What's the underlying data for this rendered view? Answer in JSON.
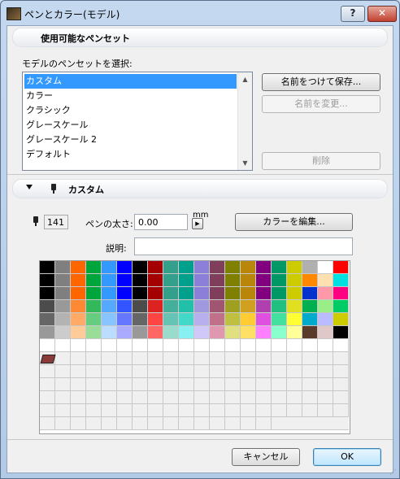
{
  "window": {
    "title": "ペンとカラー(モデル)",
    "help_label": "?",
    "close_label": "✕"
  },
  "available": {
    "section_title": "使用可能なペンセット",
    "select_label": "モデルのペンセットを選択:",
    "items": [
      {
        "label": "カスタム",
        "selected": true
      },
      {
        "label": "カラー",
        "selected": false
      },
      {
        "label": "クラシック",
        "selected": false
      },
      {
        "label": "グレースケール",
        "selected": false
      },
      {
        "label": "グレースケール 2",
        "selected": false
      },
      {
        "label": "デフォルト",
        "selected": false
      }
    ],
    "save_as_label": "名前をつけて保存...",
    "rename_label": "名前を変更...",
    "delete_label": "削除"
  },
  "custom": {
    "section_title": "カスタム",
    "pen_number": "141",
    "pen_weight_label": "ペンの太さ:",
    "pen_weight_value": "0.00",
    "unit": "mm",
    "description_label": "説明:",
    "description_value": "",
    "edit_color_label": "カラーを編集..."
  },
  "palette": {
    "rows": [
      [
        "#000000",
        "#7f7f7f",
        "#ff6600",
        "#00a63c",
        "#3399ff",
        "#0000ff",
        "#000000",
        "#a50000",
        "#33a08c",
        "#00a08c",
        "#8c7fd9",
        "#7f3f5a",
        "#808000",
        "#b8860b",
        "#800080",
        "#009966",
        "#cccc00",
        "#b0b0b0",
        "#ffffff",
        "#ff0000"
      ],
      [
        "#000000",
        "#7f7f7f",
        "#ff6600",
        "#00a63c",
        "#3399ff",
        "#0000ff",
        "#000000",
        "#a50000",
        "#33a08c",
        "#00a08c",
        "#8c7fd9",
        "#7f3f5a",
        "#808000",
        "#b8860b",
        "#800080",
        "#009966",
        "#cccc00",
        "#ff8800",
        "#ffe0b0",
        "#00e0e0"
      ],
      [
        "#000000",
        "#7f7f7f",
        "#ff6600",
        "#00a63c",
        "#3399ff",
        "#0000ff",
        "#000000",
        "#a50000",
        "#33a08c",
        "#00a08c",
        "#8c7fd9",
        "#7f3f5a",
        "#808000",
        "#b8860b",
        "#800080",
        "#009966",
        "#cccc00",
        "#0033cc",
        "#ff99aa",
        "#ff0080"
      ],
      [
        "#4c4c4c",
        "#999999",
        "#ff8833",
        "#33b85a",
        "#55aaff",
        "#3355ff",
        "#4c4c4c",
        "#dd2222",
        "#44b09c",
        "#22c0a8",
        "#a099e0",
        "#a05570",
        "#a0a020",
        "#d0a020",
        "#b040b0",
        "#22c080",
        "#e0e020",
        "#00b050",
        "#99ee88",
        "#00cc66"
      ],
      [
        "#666666",
        "#b3b3b3",
        "#ffaa66",
        "#66cc80",
        "#88c4ff",
        "#6677ff",
        "#666666",
        "#ff4444",
        "#66c4b4",
        "#44d8c8",
        "#b8b0ee",
        "#c07088",
        "#c0c040",
        "#ffcc33",
        "#e050e0",
        "#44e0a0",
        "#ffff33",
        "#00aacc",
        "#bbbbff",
        "#cccc00"
      ],
      [
        "#999999",
        "#cccccc",
        "#ffcc99",
        "#99dd99",
        "#bbddff",
        "#aaaaff",
        "#999999",
        "#ff6666",
        "#99dccc",
        "#88f0f0",
        "#d0c8f8",
        "#e098b0",
        "#e0e080",
        "#ffe066",
        "#ff80ff",
        "#88ffcc",
        "#ffff99",
        "#5a3a2a",
        "#e0c8c8",
        "#000000"
      ]
    ],
    "selected_color": "#8b3a3a"
  },
  "buttons": {
    "cancel_label": "キャンセル",
    "ok_label": "OK"
  }
}
